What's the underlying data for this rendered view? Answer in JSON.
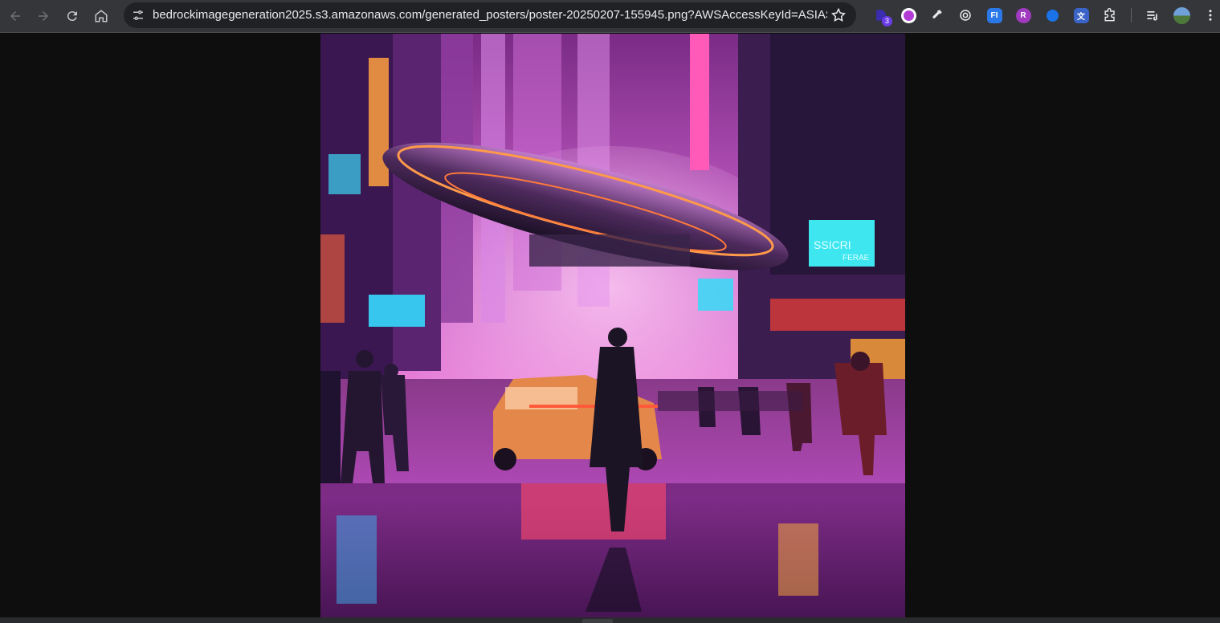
{
  "browser": {
    "url": "bedrockimagegeneration2025.s3.amazonaws.com/generated_posters/poster-20250207-155945.png?AWSAccessKeyId=ASIASQBOHY...",
    "nav_icons": [
      "back-arrow-icon",
      "forward-arrow-icon",
      "reload-icon",
      "home-icon"
    ],
    "site_info_icon": "tune-icon",
    "bookmark_icon": "star-outline-icon",
    "extension_badge": "3",
    "extension_label_fi": "FI",
    "extension_label_r": "R",
    "extensions": [
      {
        "name": "puzzle-counter-extension-icon",
        "color": "#4f3bd6"
      },
      {
        "name": "brain-extension-icon",
        "color": "#b23bd6"
      },
      {
        "name": "eyedropper-extension-icon",
        "color": "#e8eaed"
      },
      {
        "name": "target-extension-icon",
        "color": "#e8eaed"
      },
      {
        "name": "fi-extension-icon",
        "color": "#2b79e8"
      },
      {
        "name": "r-extension-icon",
        "color": "#a03bbf"
      },
      {
        "name": "blue-circle-extension-icon",
        "color": "#1a73e8"
      },
      {
        "name": "translate-extension-icon",
        "color": "#3a64c8"
      },
      {
        "name": "extensions-puzzle-icon",
        "color": "#e8eaed"
      }
    ],
    "right_icons": [
      "reading-list-icon",
      "profile-avatar-icon",
      "kebab-menu-icon"
    ]
  },
  "image": {
    "subject": "poster",
    "sign_text_1": "SSICRI",
    "sign_text_2": "FERAE"
  }
}
